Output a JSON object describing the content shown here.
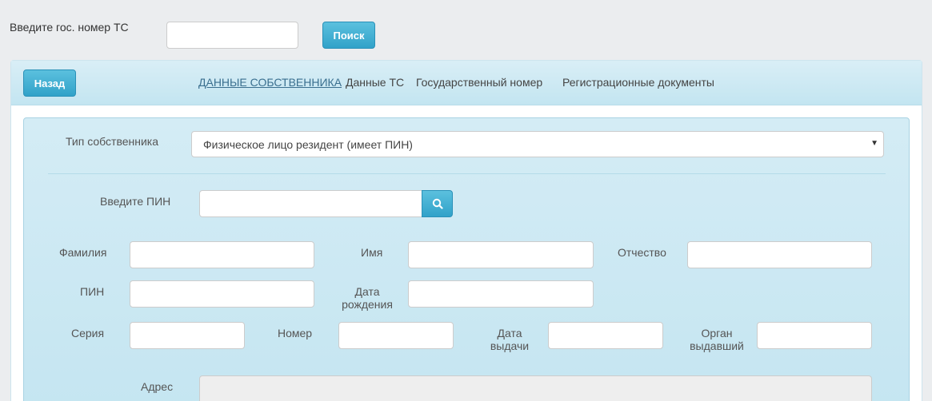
{
  "search": {
    "label": "Введите гос. номер ТС",
    "value": "",
    "button_label": "Поиск"
  },
  "header": {
    "back_label": "Назад",
    "tabs": [
      {
        "label": "ДАННЫЕ СОБСТВЕННИКА",
        "active": true
      },
      {
        "label": "Данные ТС",
        "active": false
      },
      {
        "label": "Государственный номер",
        "active": false
      },
      {
        "label": "Регистрационные документы",
        "active": false
      }
    ]
  },
  "form": {
    "owner_type_label": "Тип собственника",
    "owner_type_value": "Физическое лицо резидент (имеет ПИН)",
    "pin_search_label": "Введите ПИН",
    "surname_label": "Фамилия",
    "name_label": "Имя",
    "patronymic_label": "Отчество",
    "pin_label": "ПИН",
    "birthdate_label_line1": "Дата",
    "birthdate_label_line2": "рождения",
    "series_label": "Серия",
    "number_label": "Номер",
    "issue_date_label_line1": "Дата",
    "issue_date_label_line2": "выдачи",
    "issuer_label_line1": "Орган",
    "issuer_label_line2": "выдавший",
    "address_label": "Адрес"
  },
  "colors": {
    "accent": "#31a2c9",
    "panel_bg": "#c9e7f2"
  }
}
